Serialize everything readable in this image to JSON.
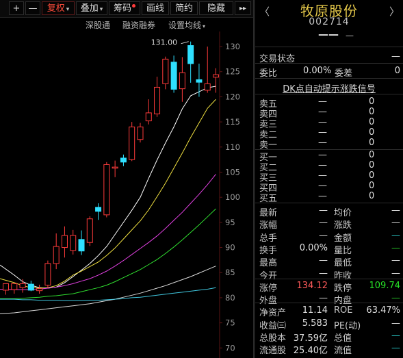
{
  "toolbar": {
    "plus": "+",
    "minus": "—",
    "fuquan": "复权",
    "diejia": "叠加",
    "chouma": "筹码",
    "huaxian": "画线",
    "jianyue": "简约",
    "yincang": "隐藏",
    "next": "▸▸"
  },
  "subbar": {
    "shengutong": "深股通",
    "rongzi": "融资融券",
    "set_ma": "设置均线"
  },
  "chart_data": {
    "type": "candlestick",
    "yticks": [
      130,
      125,
      120,
      115,
      110,
      105,
      100,
      95,
      90,
      85,
      80,
      75,
      70
    ],
    "ylim": [
      68,
      133
    ],
    "high_label": "131.00",
    "candles": [
      {
        "o": 81.5,
        "h": 82.3,
        "l": 80.6,
        "c": 82.8,
        "up": true
      },
      {
        "o": 81.6,
        "h": 82.4,
        "l": 80.8,
        "c": 82.8,
        "up": true
      },
      {
        "o": 82.8,
        "h": 83.7,
        "l": 81.0,
        "c": 82.0,
        "up": true
      },
      {
        "o": 82.7,
        "h": 83.4,
        "l": 81.3,
        "c": 81.5,
        "up": false
      },
      {
        "o": 81.4,
        "h": 82.6,
        "l": 80.8,
        "c": 81.8,
        "up": true
      },
      {
        "o": 82.5,
        "h": 87.4,
        "l": 82.0,
        "c": 86.8,
        "up": true
      },
      {
        "o": 86.8,
        "h": 92.8,
        "l": 85.7,
        "c": 90.2,
        "up": true
      },
      {
        "o": 90.0,
        "h": 94.2,
        "l": 88.0,
        "c": 92.4,
        "up": true
      },
      {
        "o": 92.4,
        "h": 93.5,
        "l": 88.6,
        "c": 89.4,
        "up": true
      },
      {
        "o": 89.3,
        "h": 93.4,
        "l": 88.5,
        "c": 91.6,
        "up": false
      },
      {
        "o": 91.0,
        "h": 96.2,
        "l": 90.3,
        "c": 95.7,
        "up": true
      },
      {
        "o": 97.2,
        "h": 98.8,
        "l": 95.5,
        "c": 98.0,
        "up": false
      },
      {
        "o": 96.5,
        "h": 107.0,
        "l": 96.0,
        "c": 106.5,
        "up": true
      },
      {
        "o": 105.8,
        "h": 107.3,
        "l": 104.0,
        "c": 106.0,
        "up": true
      },
      {
        "o": 107.0,
        "h": 108.5,
        "l": 106.2,
        "c": 107.8,
        "up": false
      },
      {
        "o": 107.5,
        "h": 115.0,
        "l": 107.2,
        "c": 114.0,
        "up": true
      },
      {
        "o": 114.0,
        "h": 114.8,
        "l": 110.9,
        "c": 111.5,
        "up": true
      },
      {
        "o": 115.2,
        "h": 119.5,
        "l": 114.5,
        "c": 116.8,
        "up": true
      },
      {
        "o": 116.6,
        "h": 124.0,
        "l": 116.0,
        "c": 121.9,
        "up": true
      },
      {
        "o": 122.6,
        "h": 128.0,
        "l": 121.5,
        "c": 127.5,
        "up": true
      },
      {
        "o": 126.9,
        "h": 128.2,
        "l": 120.8,
        "c": 121.5,
        "up": false
      },
      {
        "o": 121.6,
        "h": 127.9,
        "l": 119.0,
        "c": 124.8,
        "up": true
      },
      {
        "o": 126.6,
        "h": 131.0,
        "l": 122.8,
        "c": 130.2,
        "up": false
      },
      {
        "o": 123.4,
        "h": 126.6,
        "l": 120.0,
        "c": 122.9,
        "up": false
      },
      {
        "o": 121.3,
        "h": 130.0,
        "l": 120.8,
        "c": 122.6,
        "up": true
      },
      {
        "o": 123.9,
        "h": 125.7,
        "l": 120.8,
        "c": 124.4,
        "up": true
      }
    ],
    "ma_lines": [
      {
        "color": "#ffffff",
        "values": [
          86.5,
          84.5,
          83.2,
          82.5,
          82.0,
          81.9,
          82.1,
          83.0,
          84.2,
          85.5,
          86.8,
          88.4,
          90.2,
          92.6,
          95.0,
          97.4,
          100.0,
          103.8,
          107.4,
          110.8,
          114.0,
          117.6,
          120.2,
          121.0,
          121.8,
          122.1
        ]
      },
      {
        "color": "#f0e040",
        "values": [
          83.8,
          83.0,
          82.4,
          82.0,
          81.9,
          82.0,
          82.4,
          83.3,
          84.5,
          85.3,
          86.2,
          87.1,
          88.4,
          89.9,
          91.7,
          93.5,
          95.3,
          97.5,
          100.1,
          102.8,
          105.8,
          108.8,
          111.9,
          114.8,
          117.7,
          119.5
        ]
      },
      {
        "color": "#e040e0",
        "values": [
          81.7,
          81.6,
          81.6,
          81.6,
          81.7,
          81.9,
          82.1,
          82.4,
          82.8,
          83.3,
          83.8,
          84.5,
          85.3,
          86.3,
          87.4,
          88.6,
          89.8,
          91.0,
          92.3,
          93.8,
          95.4,
          97.0,
          98.8,
          100.6,
          102.5,
          104.6
        ]
      },
      {
        "color": "#30e030",
        "values": [
          79.8,
          79.8,
          79.9,
          80.0,
          80.1,
          80.3,
          80.4,
          80.6,
          80.8,
          81.2,
          81.6,
          82.0,
          82.5,
          83.2,
          84.0,
          84.8,
          85.6,
          86.6,
          87.6,
          88.8,
          90.1,
          91.5,
          93.0,
          94.5,
          96.1,
          97.7
        ]
      },
      {
        "color": "#dcdcdc",
        "values": [
          76.8,
          77.0,
          77.2,
          77.4,
          77.6,
          77.8,
          78.0,
          78.2,
          78.4,
          78.6,
          78.8,
          79.1,
          79.4,
          79.7,
          80.1,
          80.5,
          80.9,
          81.4,
          81.9,
          82.4,
          83.0,
          83.6,
          84.2,
          84.9,
          85.6,
          86.3
        ]
      },
      {
        "color": "#40c8e0",
        "values": [
          79.7,
          79.7,
          79.6,
          79.6,
          79.5,
          79.5,
          79.5,
          79.4,
          79.4,
          79.4,
          79.5,
          79.5,
          79.6,
          79.7,
          79.8,
          80.0,
          80.1,
          80.3,
          80.5,
          80.7,
          80.9,
          81.1,
          81.3,
          81.5,
          81.7,
          82.0
        ]
      }
    ]
  },
  "quote": {
    "name": "牧原股份",
    "code": "002714",
    "price": "——",
    "change": "—",
    "nav_left": "〈",
    "nav_right": "〉",
    "trade_status_label": "交易状态",
    "trade_status_value": "—",
    "weibi_label": "委比",
    "weibi_value": "0.00%",
    "weicha_label": "委差",
    "weicha_value": "0",
    "dk_link": "DK点自动提示涨跌信号",
    "sell": [
      {
        "label": "卖五",
        "price": "—",
        "vol": "0"
      },
      {
        "label": "卖四",
        "price": "—",
        "vol": "0"
      },
      {
        "label": "卖三",
        "price": "—",
        "vol": "0"
      },
      {
        "label": "卖二",
        "price": "—",
        "vol": "0"
      },
      {
        "label": "卖一",
        "price": "—",
        "vol": "0"
      }
    ],
    "buy": [
      {
        "label": "买一",
        "price": "—",
        "vol": "0"
      },
      {
        "label": "买二",
        "price": "—",
        "vol": "0"
      },
      {
        "label": "买三",
        "price": "—",
        "vol": "0"
      },
      {
        "label": "买四",
        "price": "—",
        "vol": "0"
      },
      {
        "label": "买五",
        "price": "—",
        "vol": "0"
      }
    ],
    "stats": [
      {
        "l1": "最新",
        "v1": "—",
        "l2": "均价",
        "v2": "—"
      },
      {
        "l1": "涨幅",
        "v1": "—",
        "l2": "涨跌",
        "v2": "—"
      },
      {
        "l1": "总手",
        "v1": "—",
        "l2": "金额",
        "v2": "—"
      },
      {
        "l1": "换手",
        "v1": "0.00%",
        "l2": "量比",
        "v2": "—"
      },
      {
        "l1": "最高",
        "v1": "—",
        "l2": "最低",
        "v2": "—"
      },
      {
        "l1": "今开",
        "v1": "—",
        "l2": "昨收",
        "v2": "—"
      },
      {
        "l1": "涨停",
        "v1": "134.12",
        "l2": "跌停",
        "v2": "109.74"
      },
      {
        "l1": "外盘",
        "v1": "—",
        "l2": "内盘",
        "v2": "—"
      },
      {
        "l1": "净资产",
        "v1": "11.14",
        "l2": "ROE",
        "v2": "63.47%"
      },
      {
        "l1": "收益㈢",
        "v1": "5.583",
        "l2": "PE(动)",
        "v2": "—"
      },
      {
        "l1": "总股本",
        "v1": "37.59亿",
        "l2": "总值",
        "v2": "—"
      },
      {
        "l1": "流通股",
        "v1": "25.40亿",
        "l2": "流值",
        "v2": "—"
      }
    ]
  }
}
